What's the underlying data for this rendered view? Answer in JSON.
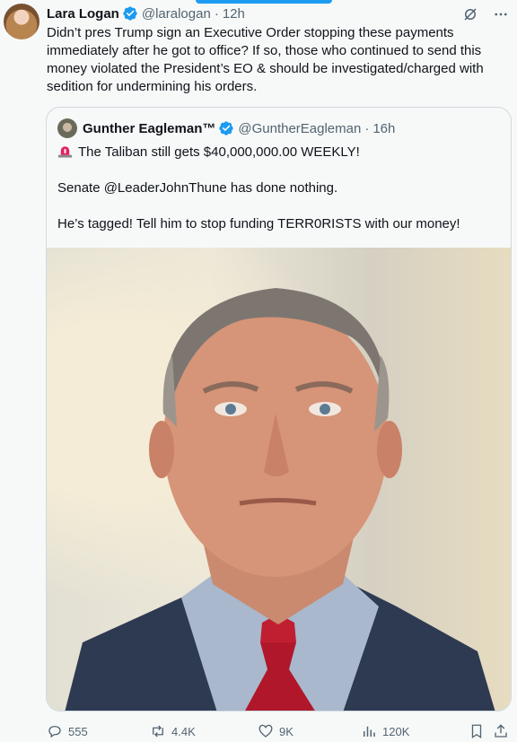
{
  "tweet": {
    "author_name": "Lara Logan",
    "author_handle": "@laralogan",
    "time": "12h",
    "text": "Didn’t pres Trump sign an Executive Order stopping these payments immediately after he got to office? If so, those who continued to send this money violated the President’s EO & should be investigated/charged with sedition for undermining his orders."
  },
  "quote": {
    "author_name": "Gunther Eagleman™",
    "author_handle": "@GuntherEagleman",
    "time": "16h",
    "line1": "The Taliban still gets $40,000,000.00 WEEKLY!",
    "line2": "Senate @LeaderJohnThune has done nothing.",
    "line3": "He’s tagged!  Tell him to stop funding TERR0RISTS with our money!"
  },
  "actions": {
    "replies": "555",
    "reposts": "4.4K",
    "likes": "9K",
    "views": "120K"
  },
  "colors": {
    "accent": "#1d9bf0",
    "muted": "#536471",
    "text": "#0f1419",
    "border": "#cfd9de"
  },
  "icons": [
    "verified-badge-icon",
    "grok-icon",
    "more-icon",
    "siren-icon",
    "reply-icon",
    "repost-icon",
    "like-icon",
    "views-icon",
    "bookmark-icon",
    "share-icon"
  ]
}
